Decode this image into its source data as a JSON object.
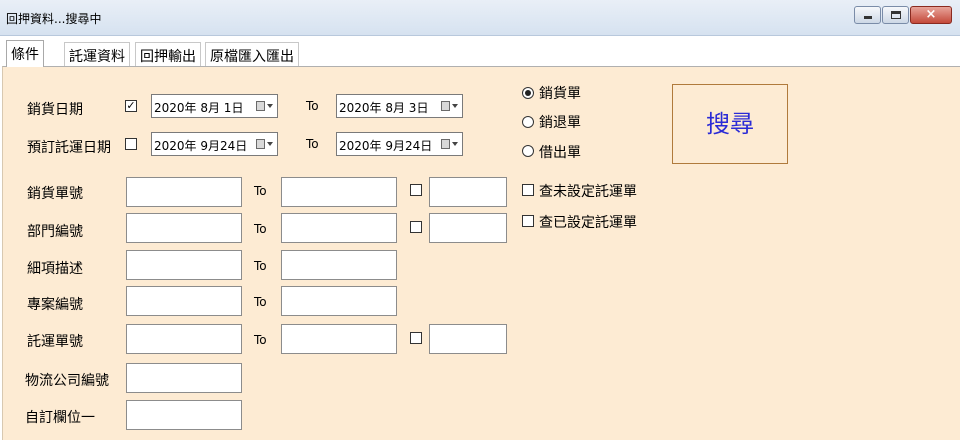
{
  "window": {
    "title": "回押資料...搜尋中",
    "minimize_icon": "minimize-icon",
    "maximize_icon": "maximize-icon",
    "close_icon": "close-icon",
    "close_glyph": "×"
  },
  "tabs": [
    {
      "label": "條件",
      "active": true
    },
    {
      "label": "託運資料",
      "active": false
    },
    {
      "label": "回押輸出",
      "active": false
    },
    {
      "label": "原檔匯入匯出",
      "active": false
    }
  ],
  "form": {
    "to_label": "To",
    "sales_date": {
      "label": "銷貨日期",
      "checked": true,
      "from": "2020年 8月 1日",
      "to": "2020年 8月 3日"
    },
    "ship_date": {
      "label": "預訂託運日期",
      "checked": false,
      "from": "2020年 9月24日",
      "to": "2020年 9月24日"
    },
    "doc_types": [
      {
        "label": "銷貨單",
        "selected": true
      },
      {
        "label": "銷退單",
        "selected": false
      },
      {
        "label": "借出單",
        "selected": false
      }
    ],
    "search_button": "搜尋",
    "sales_no": {
      "label": "銷貨單號",
      "from": "",
      "to": "",
      "extra": ""
    },
    "dept_no": {
      "label": "部門編號",
      "from": "",
      "to": "",
      "extra": ""
    },
    "item_desc": {
      "label": "細項描述",
      "from": "",
      "to": ""
    },
    "project_no": {
      "label": "專案編號",
      "from": "",
      "to": ""
    },
    "shipping_no": {
      "label": "託運單號",
      "from": "",
      "to": "",
      "extra": ""
    },
    "logistics_no": {
      "label": "物流公司編號",
      "value": ""
    },
    "custom_field_1": {
      "label": "自訂欄位一",
      "value": ""
    },
    "filters": [
      {
        "label": "查未設定託運單",
        "checked": false
      },
      {
        "label": "查已設定託運單",
        "checked": false
      }
    ]
  },
  "colors": {
    "panel_bg": "#fdebd3",
    "search_text": "#2b2bd6",
    "search_border": "#b07a3c"
  }
}
